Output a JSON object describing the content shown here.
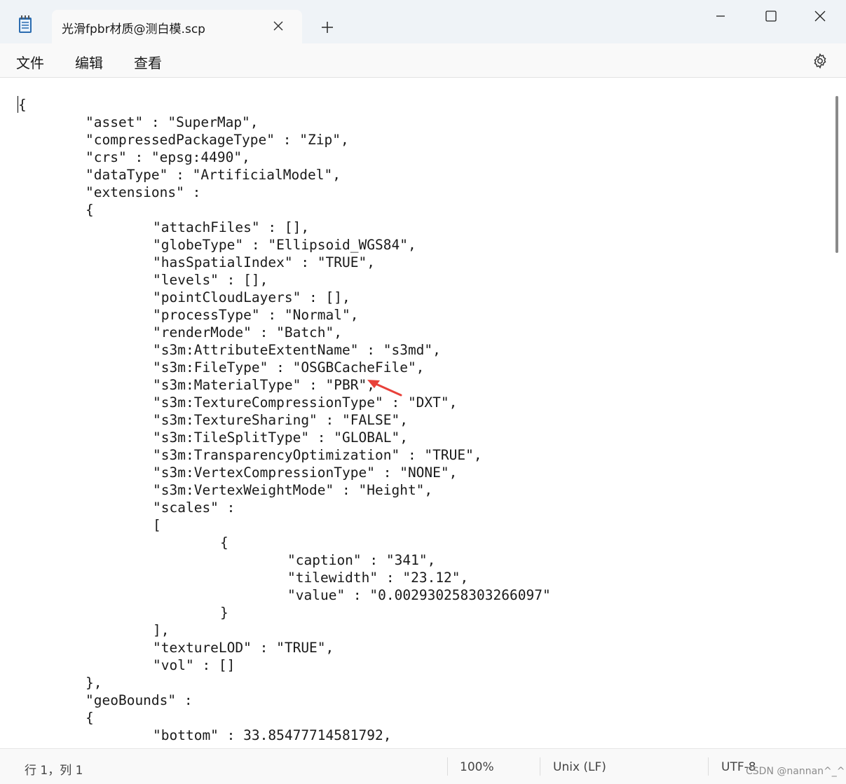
{
  "window": {
    "tab_title": "光滑fpbr材质@测白模.scp",
    "new_tab": "+"
  },
  "menu": {
    "file": "文件",
    "edit": "编辑",
    "view": "查看"
  },
  "editor": {
    "lines": [
      {
        "indent": 0,
        "text": "{"
      },
      {
        "indent": 1,
        "text": "\"asset\" : \"SuperMap\","
      },
      {
        "indent": 1,
        "text": "\"compressedPackageType\" : \"Zip\","
      },
      {
        "indent": 1,
        "text": "\"crs\" : \"epsg:4490\","
      },
      {
        "indent": 1,
        "text": "\"dataType\" : \"ArtificialModel\","
      },
      {
        "indent": 1,
        "text": "\"extensions\" :"
      },
      {
        "indent": 1,
        "text": "{"
      },
      {
        "indent": 2,
        "text": "\"attachFiles\" : [],"
      },
      {
        "indent": 2,
        "text": "\"globeType\" : \"Ellipsoid_WGS84\","
      },
      {
        "indent": 2,
        "text": "\"hasSpatialIndex\" : \"TRUE\","
      },
      {
        "indent": 2,
        "text": "\"levels\" : [],"
      },
      {
        "indent": 2,
        "text": "\"pointCloudLayers\" : [],"
      },
      {
        "indent": 2,
        "text": "\"processType\" : \"Normal\","
      },
      {
        "indent": 2,
        "text": "\"renderMode\" : \"Batch\","
      },
      {
        "indent": 2,
        "text": "\"s3m:AttributeExtentName\" : \"s3md\","
      },
      {
        "indent": 2,
        "text": "\"s3m:FileType\" : \"OSGBCacheFile\","
      },
      {
        "indent": 2,
        "text": "\"s3m:MaterialType\" : \"PBR\","
      },
      {
        "indent": 2,
        "text": "\"s3m:TextureCompressionType\" : \"DXT\","
      },
      {
        "indent": 2,
        "text": "\"s3m:TextureSharing\" : \"FALSE\","
      },
      {
        "indent": 2,
        "text": "\"s3m:TileSplitType\" : \"GLOBAL\","
      },
      {
        "indent": 2,
        "text": "\"s3m:TransparencyOptimization\" : \"TRUE\","
      },
      {
        "indent": 2,
        "text": "\"s3m:VertexCompressionType\" : \"NONE\","
      },
      {
        "indent": 2,
        "text": "\"s3m:VertexWeightMode\" : \"Height\","
      },
      {
        "indent": 2,
        "text": "\"scales\" :"
      },
      {
        "indent": 2,
        "text": "["
      },
      {
        "indent": 3,
        "text": "{"
      },
      {
        "indent": 4,
        "text": "\"caption\" : \"341\","
      },
      {
        "indent": 4,
        "text": "\"tilewidth\" : \"23.12\","
      },
      {
        "indent": 4,
        "text": "\"value\" : \"0.002930258303266097\""
      },
      {
        "indent": 3,
        "text": "}"
      },
      {
        "indent": 2,
        "text": "],"
      },
      {
        "indent": 2,
        "text": "\"textureLOD\" : \"TRUE\","
      },
      {
        "indent": 2,
        "text": "\"vol\" : []"
      },
      {
        "indent": 1,
        "text": "},"
      },
      {
        "indent": 1,
        "text": "\"geoBounds\" :"
      },
      {
        "indent": 1,
        "text": "{"
      },
      {
        "indent": 2,
        "text": "\"bottom\" : 33.85477714581792,"
      }
    ]
  },
  "status": {
    "position": "行 1，列 1",
    "zoom": "100%",
    "line_ending": "Unix (LF)",
    "encoding": "UTF-8"
  },
  "watermark": "CSDN @nannan^_^",
  "colors": {
    "titlebar_bg": "#eff3f7",
    "annotation_arrow": "#e8413a"
  }
}
